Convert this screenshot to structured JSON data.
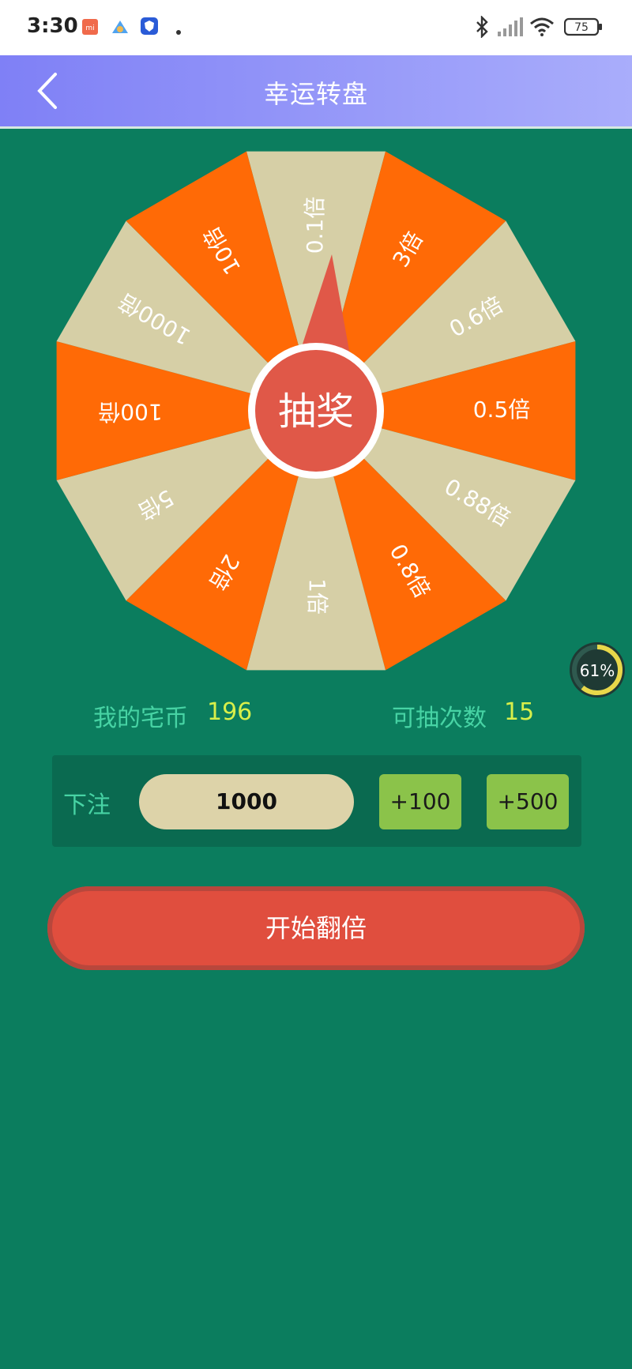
{
  "status_bar": {
    "time": "3:30",
    "battery": "75",
    "icons": [
      "mi-icon",
      "app-icon",
      "shield-icon",
      "dot-icon",
      "bluetooth-icon",
      "signal-icon",
      "wifi-icon",
      "battery-icon"
    ]
  },
  "header": {
    "title": "幸运转盘",
    "back_icon": "chevron-left-icon"
  },
  "wheel": {
    "center_label": "抽奖",
    "segments": [
      "0.1倍",
      "3倍",
      "0.6倍",
      "0.5倍",
      "0.88倍",
      "0.8倍",
      "1倍",
      "2倍",
      "5倍",
      "100倍",
      "1000倍",
      "10倍"
    ],
    "colors": {
      "orange": "#ff6a06",
      "beige": "#d6cfa6",
      "hub": "#e05848",
      "hub_ring": "#ffffff"
    }
  },
  "floating_progress": {
    "percent_text": "61%",
    "value": 0.61
  },
  "stats": {
    "coins_label": "我的宅币",
    "coins_value": "196",
    "draws_label": "可抽次数",
    "draws_value": "15"
  },
  "bet": {
    "label": "下注",
    "value": "1000",
    "plus100_label": "+100",
    "plus500_label": "+500"
  },
  "start_button": {
    "label": "开始翻倍"
  },
  "theme": {
    "background": "#0b7d5e",
    "accent_green": "#47d3a4",
    "value_yellow": "#d8ef4a",
    "button_green": "#8bc34a",
    "button_red": "#e04e3e"
  }
}
